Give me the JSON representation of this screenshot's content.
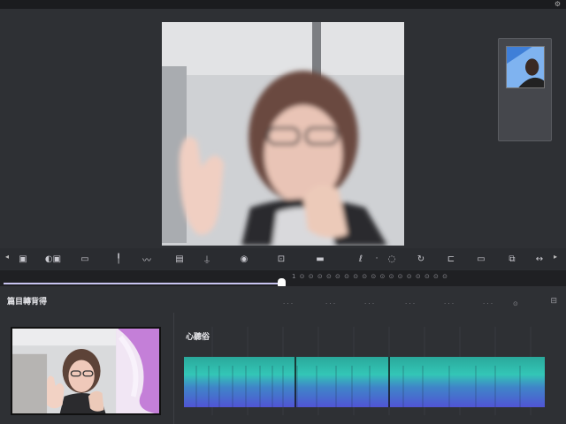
{
  "window": {
    "title": ""
  },
  "stage": {
    "preview_icon": "video-preview",
    "pip_icon": "pip-thumbnail"
  },
  "toolbar": {
    "tools": [
      {
        "name": "media",
        "glyph": "▣"
      },
      {
        "name": "text",
        "glyph": "◐▣"
      },
      {
        "name": "transition",
        "glyph": "▭"
      },
      {
        "name": "pin",
        "glyph": "╿"
      },
      {
        "name": "effects",
        "glyph": "〰"
      },
      {
        "name": "folder",
        "glyph": "▤"
      },
      {
        "name": "mic",
        "glyph": "⍊"
      },
      {
        "name": "sticker",
        "glyph": "◉"
      },
      {
        "name": "crop",
        "glyph": "⊡"
      },
      {
        "name": "keyboard",
        "glyph": "▬"
      },
      {
        "name": "pen",
        "glyph": "ℓ"
      },
      {
        "name": "dot",
        "glyph": "·"
      },
      {
        "name": "circle",
        "glyph": "◌"
      },
      {
        "name": "link",
        "glyph": "↻"
      },
      {
        "name": "tag",
        "glyph": "⊏"
      },
      {
        "name": "frame",
        "glyph": "▭"
      },
      {
        "name": "compare",
        "glyph": "⧉"
      },
      {
        "name": "loop",
        "glyph": "↔"
      }
    ]
  },
  "ruler": {
    "progress": 0.5,
    "ticks": "1 ⊙ ⊙ ⊙ ⊙ ⊙ ⊙ ⊙ ⊙ ⊙ ⊙ ⊙ ⊙ ⊙ ⊙ ⊙ ⊙ ⊙"
  },
  "bottom": {
    "section_title": "篇目轉背得",
    "audio_label": "心聽俗",
    "corner": "⊟"
  },
  "colors": {
    "accent": "#c8c4f0",
    "wave_top": "#2fb8a8",
    "wave_bottom": "#4a5ad0"
  }
}
